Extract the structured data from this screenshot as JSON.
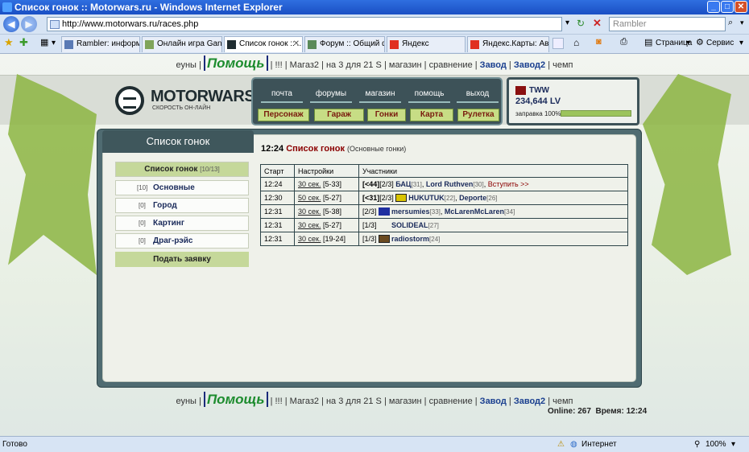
{
  "window": {
    "title": "Список гонок :: Motorwars.ru - Windows Internet Explorer"
  },
  "address": {
    "url": "http://www.motorwars.ru/races.php",
    "search_placeholder": "Rambler"
  },
  "tabs": [
    {
      "label": "Rambler: информац..."
    },
    {
      "label": "Онлайн игра Ganja..."
    },
    {
      "label": "Список гонок :: ..."
    },
    {
      "label": "Форум :: Общий фор..."
    },
    {
      "label": "Яндекс"
    },
    {
      "label": "Яндекс.Карты: Ав..."
    }
  ],
  "ie_toolbar": {
    "page": "Страница",
    "tools": "Сервис"
  },
  "toplinks": {
    "euny": "еуны",
    "help": "Помощь",
    "excl": "!!!",
    "magaz2": "Магаз2",
    "na3": "на 3 для 21 S",
    "shop": "магазин",
    "compare": "сравнение",
    "zavod": "Завод",
    "zavod2": "Завод2",
    "champ": "чемп"
  },
  "logo": {
    "title": "MOTORWARS.RU",
    "subtitle": "СКОРОСТЬ ОН-ЛАЙН"
  },
  "menu": {
    "top": [
      "почта",
      "форумы",
      "магазин",
      "помощь",
      "выход"
    ],
    "bottom": [
      "Персонаж",
      "Гараж",
      "Гонки",
      "Карта",
      "Рулетка"
    ]
  },
  "user": {
    "name": "TWW",
    "money": "234,644 LV",
    "fuel_label": "заправка 100%",
    "fuel_fraction": 1.0
  },
  "sidebar": {
    "title": "Список гонок",
    "header": {
      "label": "Список гонок",
      "count": "[10/13]"
    },
    "items": [
      {
        "count": "[10]",
        "label": "Основные"
      },
      {
        "count": "[0]",
        "label": "Город"
      },
      {
        "count": "[0]",
        "label": "Картинг"
      },
      {
        "count": "[0]",
        "label": "Драг-рэйс"
      }
    ],
    "submit": "Подать заявку"
  },
  "races": {
    "time": "12:24",
    "title": "Список гонок",
    "subtitle": "(Основные гонки)",
    "columns": [
      "Старт",
      "Настройки",
      "Участники"
    ],
    "rows": [
      {
        "start": "12:24",
        "setting": "30 сек.",
        "range": "[5-33]",
        "limit": "[<44]",
        "slots": "[2/3]",
        "p1": "БАЦ",
        "l1": "[31]",
        "p2": "Lord Ruthven",
        "l2": "[30]",
        "join": "Вступить >>"
      },
      {
        "start": "12:30",
        "setting": "50 сек.",
        "range": "[5-27]",
        "limit": "[<31]",
        "slots": "[2/3]",
        "p1": "HUKUTUK",
        "l1": "[22]",
        "p2": "Deporte",
        "l2": "[26]",
        "join": ""
      },
      {
        "start": "12:31",
        "setting": "30 сек.",
        "range": "[5-38]",
        "limit": "",
        "slots": "[2/3]",
        "p1": "mersumies",
        "l1": "[33]",
        "p2": "McLarenMcLaren",
        "l2": "[34]",
        "join": ""
      },
      {
        "start": "12:31",
        "setting": "30 сек.",
        "range": "[5-27]",
        "limit": "",
        "slots": "[1/3]",
        "p1": "SOLIDEAL",
        "l1": "[27]",
        "p2": "",
        "l2": "",
        "join": ""
      },
      {
        "start": "12:31",
        "setting": "30 сек.",
        "range": "[19-24]",
        "limit": "",
        "slots": "[1/3]",
        "p1": "radiostorm",
        "l1": "[24]",
        "p2": "",
        "l2": "",
        "join": ""
      }
    ]
  },
  "footer": {
    "online": "Online: 267",
    "time": "Время: 12:24"
  },
  "statusbar": {
    "left": "Готово",
    "zone": "Интернет",
    "zoom": "100%"
  },
  "colors": {
    "accent_green": "#8cb542",
    "panel": "#4f6b71",
    "brand_dark": "#1f2c30",
    "danger": "#8b0000"
  }
}
